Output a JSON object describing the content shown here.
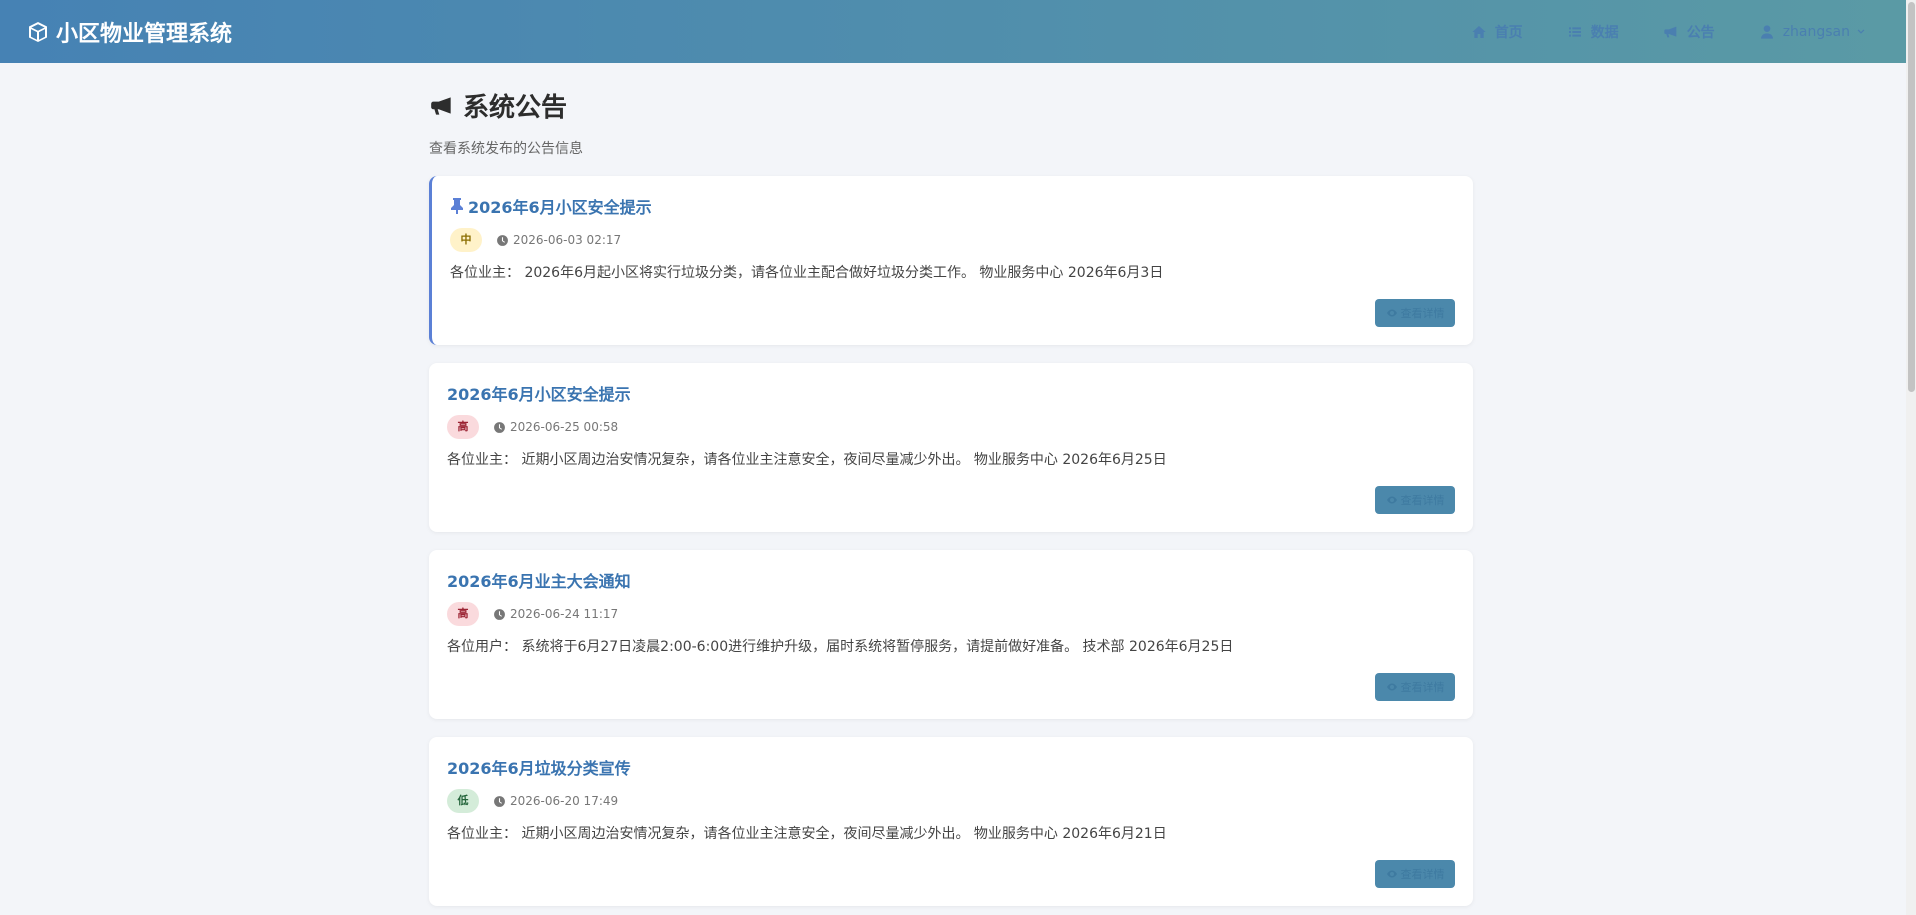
{
  "navbar": {
    "brand": "小区物业管理系统",
    "items": [
      {
        "label": "首页",
        "icon": "home-icon"
      },
      {
        "label": "数据",
        "icon": "list-icon"
      },
      {
        "label": "公告",
        "icon": "bullhorn-icon"
      }
    ],
    "user": {
      "label": "zhangsan",
      "icon": "user-icon"
    }
  },
  "page": {
    "title": "系统公告",
    "subtitle": "查看系统发布的公告信息"
  },
  "detail_label": "查看详情",
  "colors": {
    "navbar_start": "#4682b4",
    "navbar_end": "#5a9aa5",
    "title": "#3a74b0",
    "pinned_border": "#5b80d6",
    "badge_mid": "#fff2c9",
    "badge_high": "#fadadd",
    "badge_low": "#d4ecd9"
  },
  "announcements": [
    {
      "title": "2026年6月小区安全提示",
      "pinned": true,
      "priority": "中",
      "date": "2026-06-03 02:17",
      "content": "各位业主： 2026年6月起小区将实行垃圾分类，请各位业主配合做好垃圾分类工作。 物业服务中心 2026年6月3日"
    },
    {
      "title": "2026年6月小区安全提示",
      "pinned": false,
      "priority": "高",
      "date": "2026-06-25 00:58",
      "content": "各位业主： 近期小区周边治安情况复杂，请各位业主注意安全，夜间尽量减少外出。 物业服务中心 2026年6月25日"
    },
    {
      "title": "2026年6月业主大会通知",
      "pinned": false,
      "priority": "高",
      "date": "2026-06-24 11:17",
      "content": "各位用户： 系统将于6月27日凌晨2:00-6:00进行维护升级，届时系统将暂停服务，请提前做好准备。 技术部 2026年6月25日"
    },
    {
      "title": "2026年6月垃圾分类宣传",
      "pinned": false,
      "priority": "低",
      "date": "2026-06-20 17:49",
      "content": "各位业主： 近期小区周边治安情况复杂，请各位业主注意安全，夜间尽量减少外出。 物业服务中心 2026年6月21日"
    }
  ]
}
